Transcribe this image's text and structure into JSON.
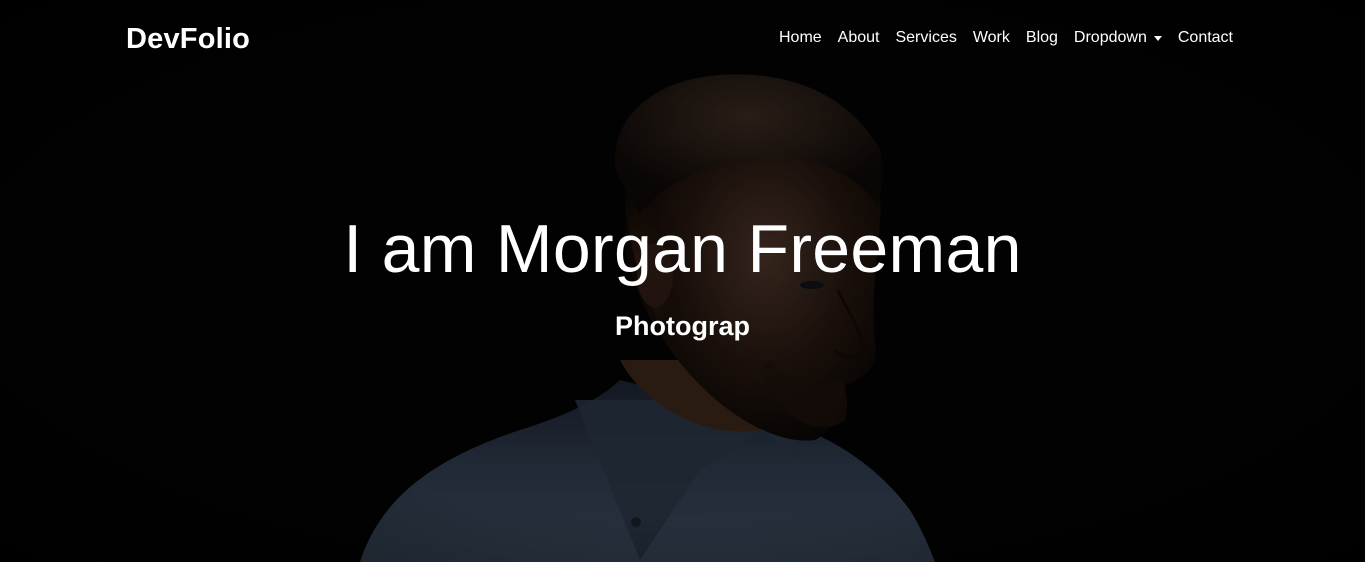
{
  "navbar": {
    "brand": "DevFolio",
    "items": [
      {
        "label": "Home"
      },
      {
        "label": "About"
      },
      {
        "label": "Services"
      },
      {
        "label": "Work"
      },
      {
        "label": "Blog"
      },
      {
        "label": "Dropdown"
      },
      {
        "label": "Contact"
      }
    ]
  },
  "hero": {
    "title": "I am Morgan Freeman",
    "subtitle": "Photograp"
  },
  "colors": {
    "background": "#050303",
    "text": "#ffffff",
    "shirt": "#3b4a5c",
    "skin_highlight": "#6a4a38"
  },
  "icons": {
    "dropdown": "caret-down-icon"
  }
}
